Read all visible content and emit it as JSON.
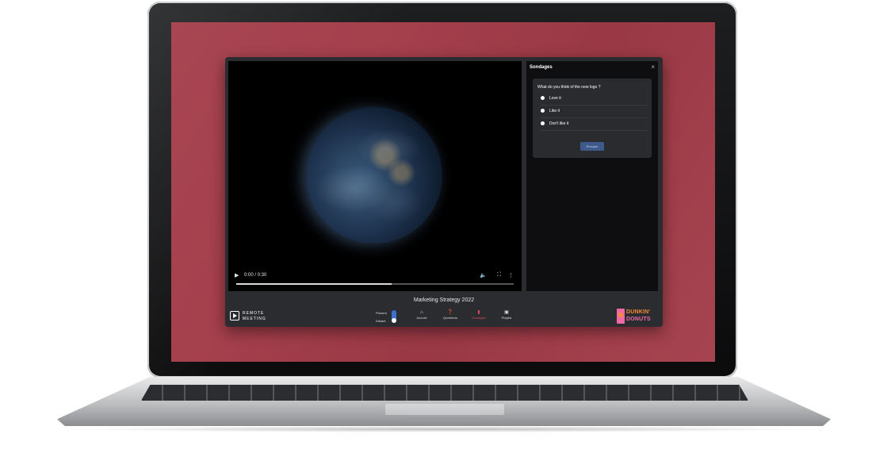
{
  "player": {
    "time": "0:00 / 0:30",
    "progress": 0.56,
    "icons": {
      "play": "play-icon",
      "volume": "volume-icon",
      "fullscreen": "fullscreen-icon",
      "more": "more-vertical-icon"
    }
  },
  "panel": {
    "title": "Sondages",
    "close_icon": "close-icon",
    "question": "What do you think of the new logo ?",
    "options": [
      "Love it",
      "Like it",
      "Don't like it"
    ],
    "submit_label": "Envoyer"
  },
  "bottom": {
    "meeting_title": "Marketing Strategy 2022",
    "brand_line1": "REMOTE",
    "brand_line2": "MEETING",
    "toggle": {
      "label_top": "Present",
      "label_bottom": "Distant"
    },
    "nav": [
      {
        "label": "Accueil",
        "icon": "home-icon"
      },
      {
        "label": "Questions",
        "icon": "question-icon"
      },
      {
        "label": "Sondages",
        "icon": "bar-chart-icon",
        "active": true
      },
      {
        "label": "Playlist",
        "icon": "playlist-icon"
      }
    ],
    "sponsor_line1": "DUNKIN'",
    "sponsor_line2": "DONUTS"
  },
  "colors": {
    "screen_bg": "#a33c49",
    "app_bg": "#2b2c30",
    "accent_active": "#d64a5c",
    "toggle_blue": "#3e6fd1",
    "button_blue": "#3e5a8c",
    "sponsor_orange": "#f28c38",
    "sponsor_pink": "#ef6aa5"
  }
}
